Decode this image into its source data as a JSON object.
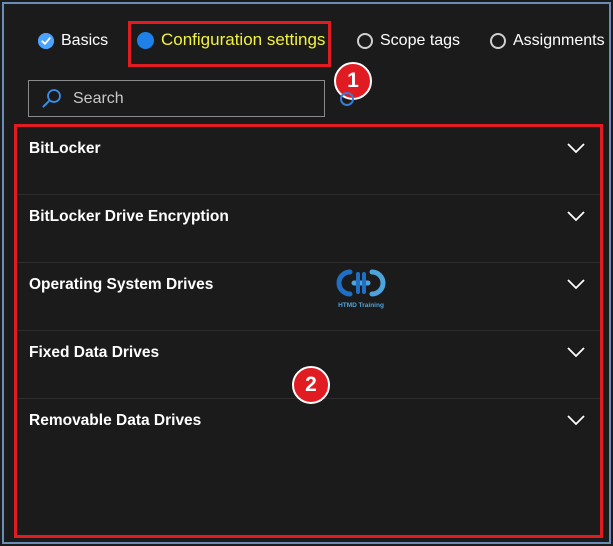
{
  "tabs": [
    {
      "label": "Basics",
      "state": "completed"
    },
    {
      "label": "Configuration settings",
      "state": "active"
    },
    {
      "label": "Scope tags",
      "state": "pending"
    },
    {
      "label": "Assignments",
      "state": "pending"
    }
  ],
  "search": {
    "placeholder": "Search"
  },
  "sections": [
    {
      "label": "BitLocker"
    },
    {
      "label": "BitLocker Drive Encryption"
    },
    {
      "label": "Operating System Drives"
    },
    {
      "label": "Fixed Data Drives"
    },
    {
      "label": "Removable Data Drives"
    }
  ],
  "annotations": {
    "badge_1": "1",
    "badge_2": "2"
  },
  "watermark": {
    "text": "HTMD Training"
  },
  "colors": {
    "accent": "#1f80e8",
    "highlight_text": "#f3f23c",
    "callout": "#e11b22",
    "background": "#1b1b1b"
  }
}
